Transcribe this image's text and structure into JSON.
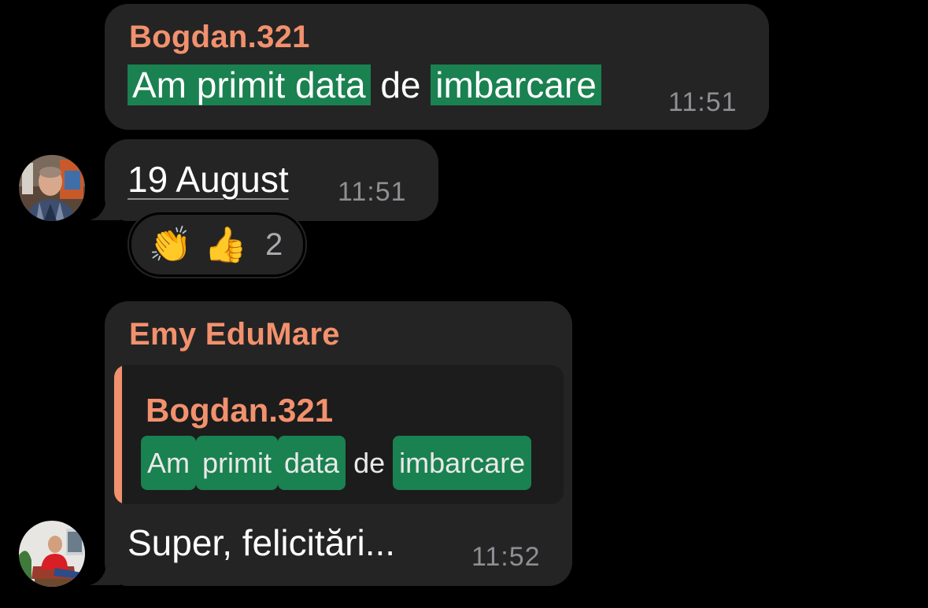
{
  "messages": [
    {
      "sender": "Bogdan.321",
      "text_parts": [
        "Am primit data",
        "de",
        "imbarcare"
      ],
      "time": "11:51"
    },
    {
      "text": "19 August",
      "time": "11:51",
      "reactions": {
        "emoji_1": "👏",
        "emoji_2": "👍",
        "count": "2"
      }
    },
    {
      "sender": "Emy EduMare",
      "reply": {
        "sender": "Bogdan.321",
        "text_parts": [
          "Am",
          "primit",
          "data",
          "de",
          "imbarcare"
        ]
      },
      "text": "Super, felicitări...",
      "time": "11:52"
    }
  ],
  "colors": {
    "background": "#000000",
    "bubble": "#242424",
    "sender_name": "#f2916d",
    "highlight": "#1a8150",
    "timestamp": "#8e8e93"
  },
  "icons": {
    "avatar_1": "avatar-photo-man-striped-shirt",
    "avatar_2": "avatar-photo-man-red-jacket"
  }
}
